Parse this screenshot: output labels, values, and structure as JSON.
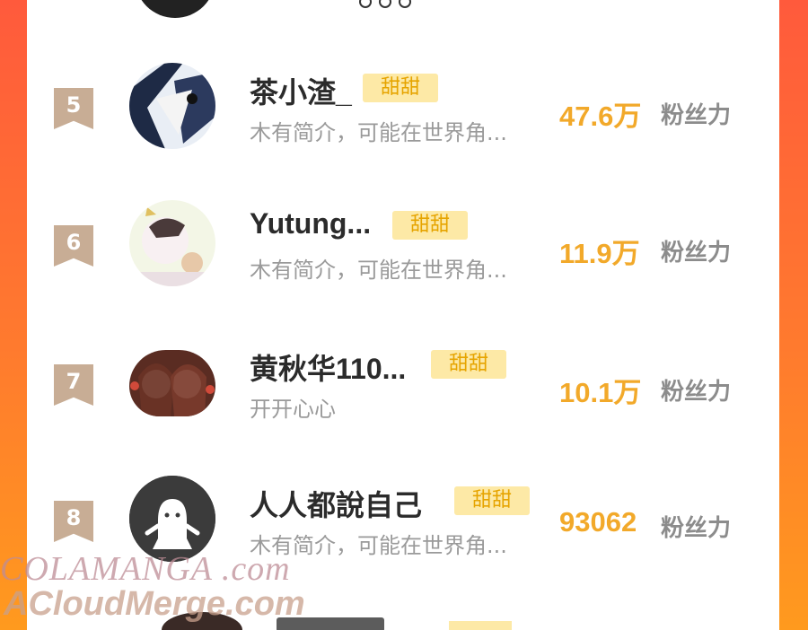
{
  "fans_label": "粉丝力",
  "colors": {
    "accent": "#f2a92a",
    "badge_bg": "#fde9a6",
    "rank_bg": "#c8ad95"
  },
  "rows": [
    {
      "rank": "5",
      "name": "茶小渣_",
      "badge": "甜甜",
      "desc": "木有简介，可能在世界角...",
      "fans": "47.6万"
    },
    {
      "rank": "6",
      "name": "Yutung...",
      "badge": "甜甜",
      "desc": "木有简介，可能在世界角...",
      "fans": "11.9万"
    },
    {
      "rank": "7",
      "name": "黄秋华110...",
      "badge": "甜甜",
      "desc": "开开心心",
      "fans": "10.1万"
    },
    {
      "rank": "8",
      "name": "人人都說自己",
      "badge": "甜甜",
      "desc": "木有简介，可能在世界角...",
      "fans": "93062"
    }
  ],
  "watermark": {
    "line1": "COLAMANGA .com",
    "line2": "ACloudMerge.com"
  }
}
